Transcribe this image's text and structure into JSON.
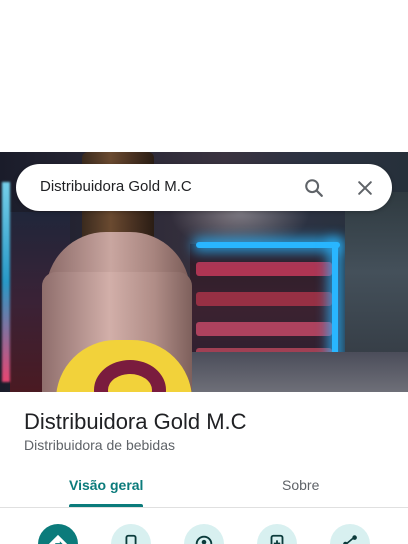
{
  "search": {
    "query": "Distribuidora Gold M.C",
    "search_icon": "search-icon",
    "close_icon": "close-icon"
  },
  "photo": {
    "description_icon": "place-photo",
    "bottle_text": "R"
  },
  "place": {
    "name": "Distribuidora Gold M.C",
    "category": "Distribuidora de bebidas"
  },
  "tabs": [
    {
      "label": "Visão geral",
      "active": true
    },
    {
      "label": "Sobre",
      "active": false
    }
  ],
  "actions": [
    {
      "icon": "directions-icon",
      "primary": true
    },
    {
      "icon": "phone-icon",
      "primary": false
    },
    {
      "icon": "location-icon",
      "primary": false
    },
    {
      "icon": "save-icon",
      "primary": false
    },
    {
      "icon": "share-icon",
      "primary": false
    }
  ],
  "colors": {
    "accent": "#0b7b7b",
    "action_bg": "#d8f0f0",
    "text_primary": "#202124",
    "text_secondary": "#5f6368"
  }
}
